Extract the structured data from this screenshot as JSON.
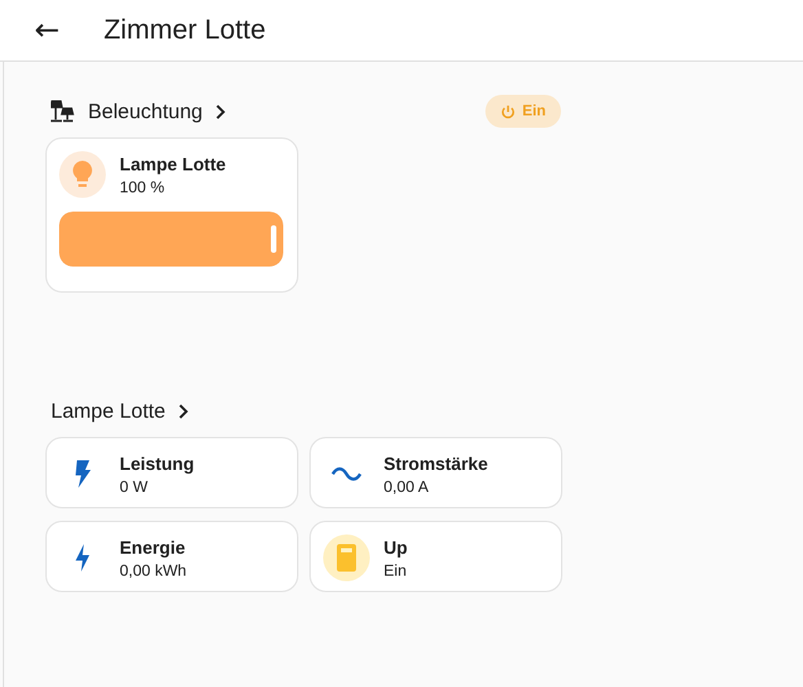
{
  "header": {
    "back_icon": "←",
    "title": "Zimmer Lotte"
  },
  "sections": [
    {
      "heading": "Beleuchtung",
      "kind": "area",
      "toggle": {
        "label": "Ein",
        "on": true
      },
      "cards": [
        {
          "kind": "light",
          "name": "Lampe Lotte",
          "state": "100 %",
          "level": 1
        }
      ]
    },
    {
      "heading": "Lampe Lotte",
      "kind": "device",
      "cards": [
        {
          "kind": "sensor",
          "name": "Leistung",
          "state": "0 W"
        },
        {
          "kind": "sensor",
          "name": "Stromstärke",
          "state": "0,00 A"
        },
        {
          "kind": "sensor",
          "name": "Energie",
          "state": "0,00 kWh"
        },
        {
          "kind": "switch",
          "name": "Up",
          "state": "Ein",
          "on": true
        }
      ]
    }
  ]
}
